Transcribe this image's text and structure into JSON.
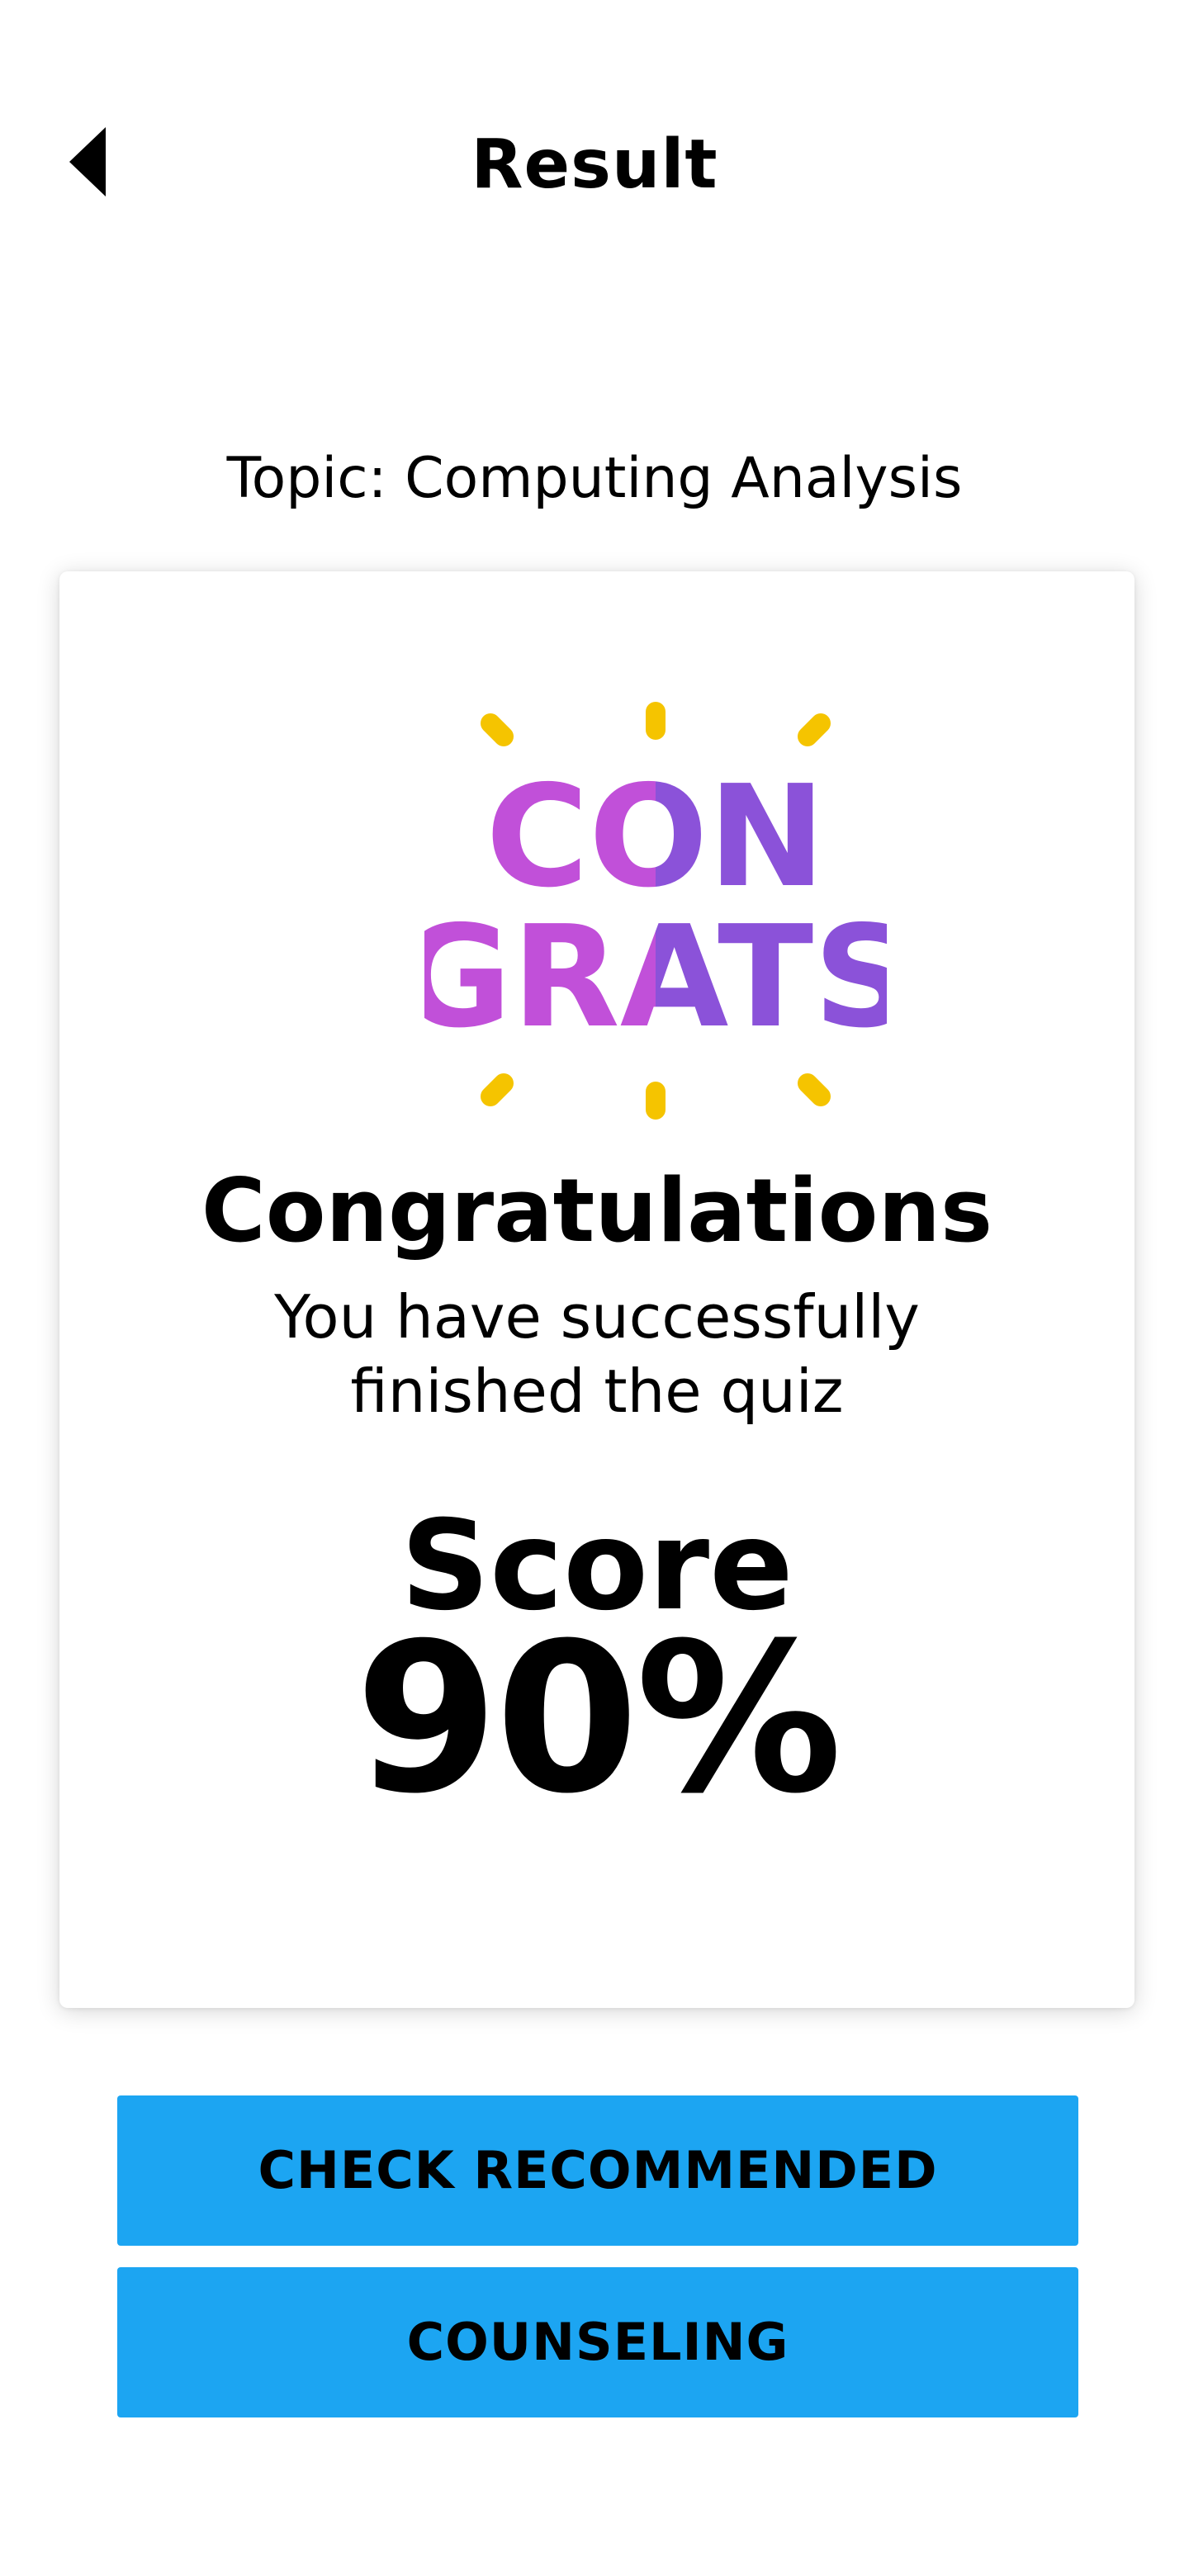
{
  "header": {
    "title": "Result",
    "back_icon": "back-triangle-icon"
  },
  "topic": {
    "text": "Topic: Computing Analysis"
  },
  "card": {
    "illustration": {
      "line1": "CON",
      "line2": "GRATS",
      "colors": {
        "rays": "#f5c400",
        "letters_left": "#c150d9",
        "letters_right": "#8b52d9"
      }
    },
    "heading": "Congratulations",
    "subtitle": "You have successfully finished the quiz",
    "score_label": "Score",
    "score_value": "90%"
  },
  "actions": {
    "check_recommended": "CHECK RECOMMENDED",
    "counseling": "COUNSELING"
  },
  "colors": {
    "button_bg": "#1ca5f2",
    "text": "#000000",
    "background": "#ffffff"
  }
}
